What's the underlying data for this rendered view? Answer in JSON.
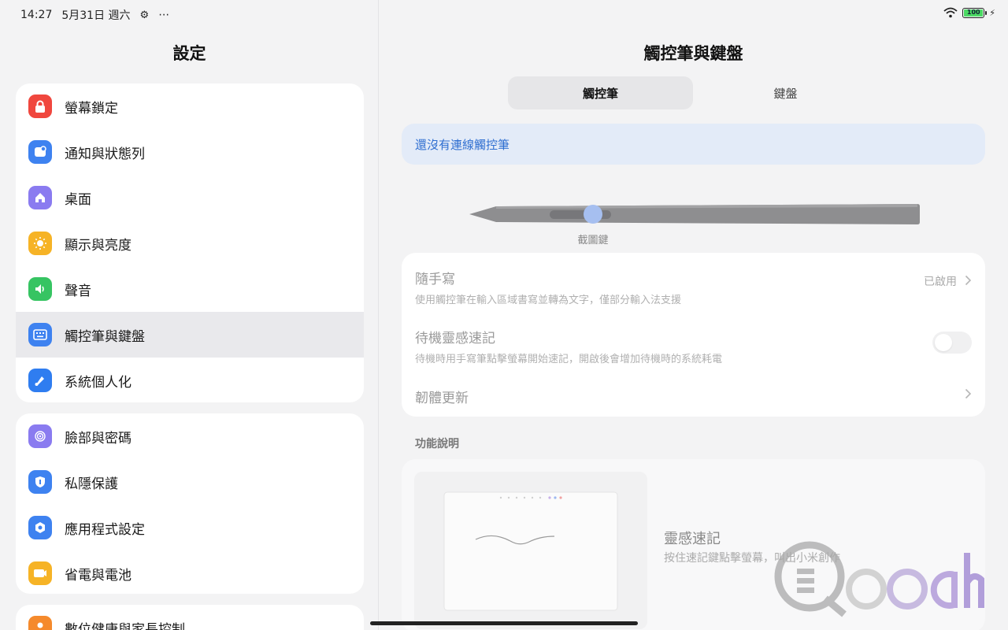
{
  "status_bar": {
    "time": "14:27",
    "date": "5月31日 週六",
    "battery": "100"
  },
  "left": {
    "title": "設定",
    "groups": [
      {
        "items": [
          {
            "label": "螢幕鎖定",
            "icon": "lock-icon",
            "color": "#f0473e"
          },
          {
            "label": "通知與狀態列",
            "icon": "notification-icon",
            "color": "#3e82f0"
          },
          {
            "label": "桌面",
            "icon": "home-icon",
            "color": "#8a7bf0"
          },
          {
            "label": "顯示與亮度",
            "icon": "sun-icon",
            "color": "#f6b326"
          },
          {
            "label": "聲音",
            "icon": "speaker-icon",
            "color": "#36c462"
          },
          {
            "label": "觸控筆與鍵盤",
            "icon": "keyboard-icon",
            "color": "#3e82f0"
          },
          {
            "label": "系統個人化",
            "icon": "brush-icon",
            "color": "#2f7df0"
          }
        ]
      },
      {
        "items": [
          {
            "label": "臉部與密碼",
            "icon": "fingerprint-icon",
            "color": "#8a7bf0"
          },
          {
            "label": "私隱保護",
            "icon": "shield-icon",
            "color": "#3e82f0"
          },
          {
            "label": "應用程式設定",
            "icon": "app-settings-icon",
            "color": "#3e82f0"
          },
          {
            "label": "省電與電池",
            "icon": "battery-icon",
            "color": "#f6b326"
          }
        ]
      },
      {
        "items": [
          {
            "label": "數位健康與家長控制",
            "icon": "person-icon",
            "color": "#f58a2c"
          }
        ]
      }
    ]
  },
  "right": {
    "title": "觸控筆與鍵盤",
    "tabs": [
      "觸控筆",
      "鍵盤"
    ],
    "notice": "還沒有連線觸控筆",
    "pen_caption": "截圖鍵",
    "settings": {
      "handwriting": {
        "title": "隨手寫",
        "subtitle": "使用觸控筆在輸入區域書寫並轉為文字，僅部分輸入法支援",
        "value": "已啟用"
      },
      "quick_note": {
        "title": "待機靈感速記",
        "subtitle": "待機時用手寫筆點擊螢幕開始速記，開啟後會增加待機時的系統耗電"
      },
      "firmware": {
        "title": "韌體更新"
      }
    },
    "section_label": "功能說明",
    "feature": {
      "title": "靈感速記",
      "desc": "按住速記鍵點擊螢幕，叫出小米創作"
    },
    "watermark": "Qooah"
  },
  "colors": {
    "accent": "#2f6fd1",
    "notice_bg": "#e3ebf8",
    "active_row": "#e9e9ec"
  }
}
